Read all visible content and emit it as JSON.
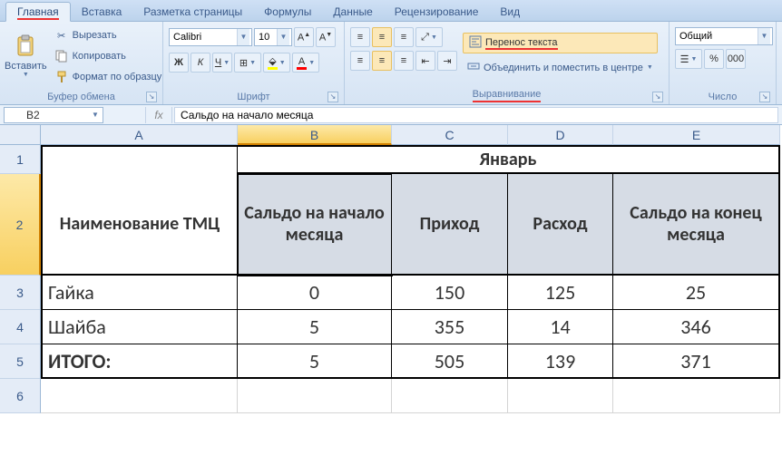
{
  "ribbon": {
    "tabs": [
      "Главная",
      "Вставка",
      "Разметка страницы",
      "Формулы",
      "Данные",
      "Рецензирование",
      "Вид"
    ],
    "active_tab": 0,
    "clipboard": {
      "paste": "Вставить",
      "cut": "Вырезать",
      "copy": "Копировать",
      "format_painter": "Формат по образцу",
      "group_label": "Буфер обмена"
    },
    "font": {
      "name": "Calibri",
      "size": "10",
      "group_label": "Шрифт"
    },
    "alignment": {
      "wrap_text": "Перенос текста",
      "merge_center": "Объединить и поместить в центре",
      "group_label": "Выравнивание"
    },
    "number": {
      "format": "Общий",
      "group_label": "Число"
    }
  },
  "namebox": "B2",
  "formula": "Сальдо на начало месяца",
  "grid": {
    "columns": [
      "A",
      "B",
      "C",
      "D",
      "E"
    ],
    "month": "Январь",
    "header_name": "Наименование ТМЦ",
    "headers": [
      "Сальдо на начало месяца",
      "Приход",
      "Расход",
      "Сальдо на конец месяца"
    ],
    "rows": [
      {
        "name": "Гайка",
        "b": "0",
        "c": "150",
        "d": "125",
        "e": "25"
      },
      {
        "name": "Шайба",
        "b": "5",
        "c": "355",
        "d": "14",
        "e": "346"
      }
    ],
    "total_label": "ИТОГО:",
    "totals": {
      "b": "5",
      "c": "505",
      "d": "139",
      "e": "371"
    },
    "row_numbers": [
      "1",
      "2",
      "3",
      "4",
      "5",
      "6"
    ]
  },
  "chart_data": {
    "type": "table",
    "title": "Январь",
    "columns": [
      "Наименование ТМЦ",
      "Сальдо на начало месяца",
      "Приход",
      "Расход",
      "Сальдо на конец месяца"
    ],
    "rows": [
      [
        "Гайка",
        0,
        150,
        125,
        25
      ],
      [
        "Шайба",
        5,
        355,
        14,
        346
      ],
      [
        "ИТОГО:",
        5,
        505,
        139,
        371
      ]
    ]
  }
}
